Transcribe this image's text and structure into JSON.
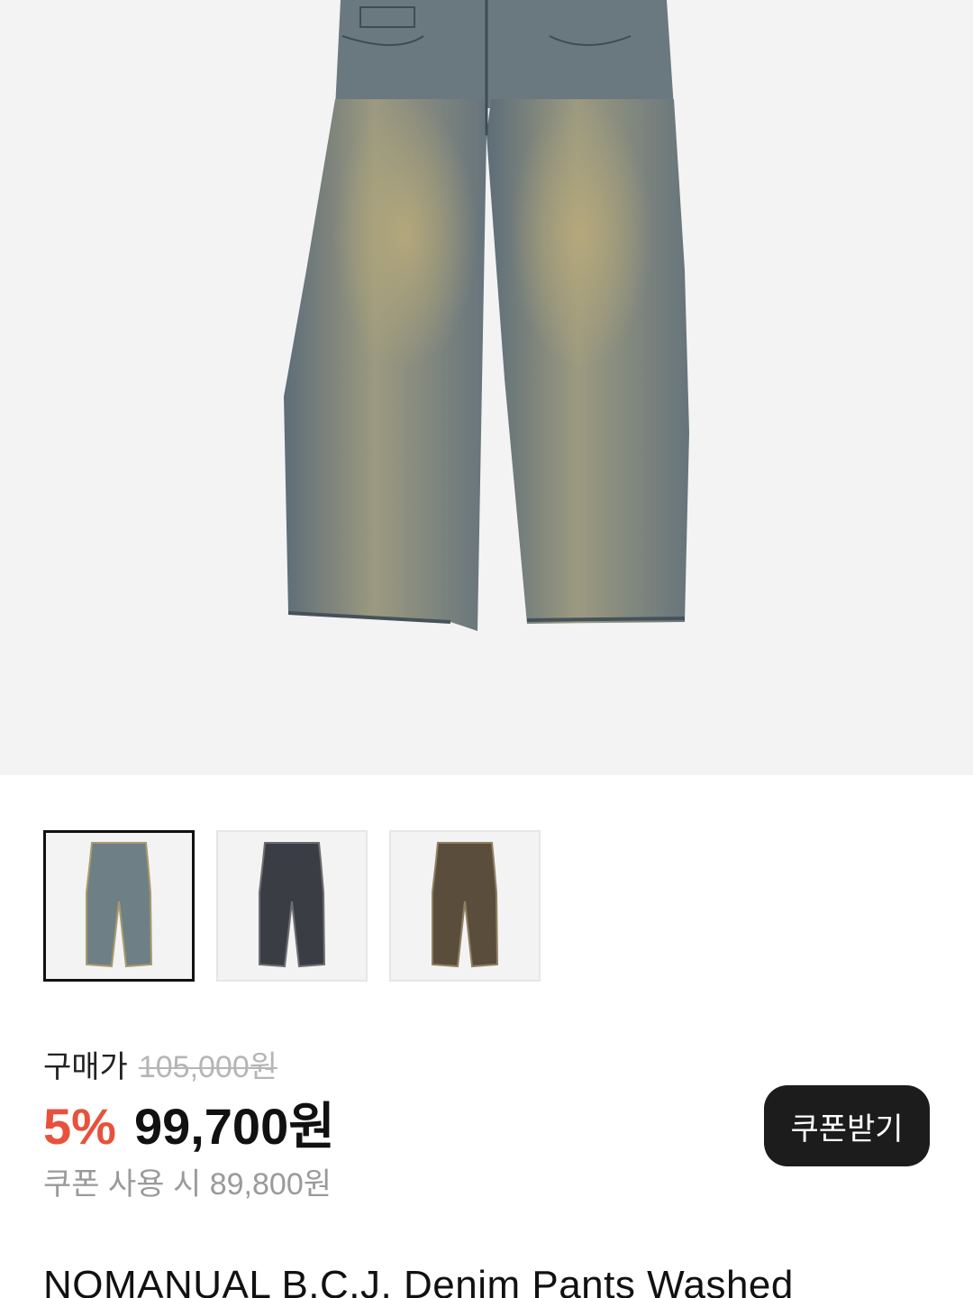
{
  "product": {
    "image_alt": "Denim pants - washed",
    "thumbnails": [
      {
        "name": "thumbnail-washed-blue",
        "color": "#6f7f86",
        "fade": "#a89c6c",
        "selected": true
      },
      {
        "name": "thumbnail-black",
        "color": "#3a3d44",
        "fade": "#6d6e72",
        "selected": false
      },
      {
        "name": "thumbnail-brown",
        "color": "#5a4d3c",
        "fade": "#8f8060",
        "selected": false
      }
    ],
    "price": {
      "original_label": "구매가",
      "original_price": "105,000원",
      "discount_rate": "5%",
      "sale_price": "99,700원",
      "coupon_price_text": "쿠폰 사용 시 89,800원"
    },
    "coupon_button_label": "쿠폰받기",
    "title": "NOMANUAL B.C.J. Denim Pants Washed"
  },
  "colors": {
    "discount": "#e8513b",
    "button_bg": "#1c1c1c",
    "hero_bg": "#f3f3f3"
  }
}
